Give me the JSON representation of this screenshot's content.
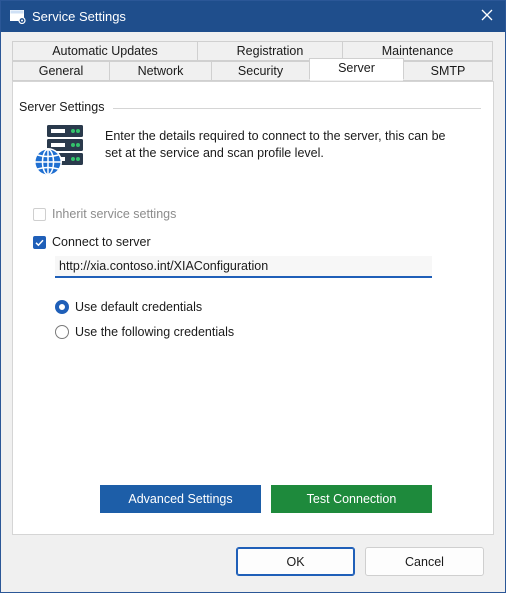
{
  "window": {
    "title": "Service Settings",
    "icon": "settings-window-icon",
    "close_icon": "close-icon"
  },
  "tabs": {
    "row1": [
      {
        "label": "Automatic Updates"
      },
      {
        "label": "Registration"
      },
      {
        "label": "Maintenance"
      }
    ],
    "row2": [
      {
        "label": "General"
      },
      {
        "label": "Network"
      },
      {
        "label": "Security"
      },
      {
        "label": "Server",
        "active": true
      },
      {
        "label": "SMTP"
      }
    ]
  },
  "server": {
    "group_title": "Server Settings",
    "icon": "server-globe-icon",
    "description": "Enter the details required to connect to the server, this can be set at the service and scan profile level.",
    "inherit_label": "Inherit service settings",
    "inherit_checked": false,
    "inherit_enabled": false,
    "connect_label": "Connect to server",
    "connect_checked": true,
    "url_value": "http://xia.contoso.int/XIAConfiguration",
    "credentials": [
      {
        "label": "Use default credentials",
        "selected": true
      },
      {
        "label": "Use the following credentials",
        "selected": false
      }
    ],
    "advanced_button": "Advanced Settings",
    "test_button": "Test Connection"
  },
  "dialog": {
    "ok_label": "OK",
    "cancel_label": "Cancel"
  },
  "colors": {
    "titlebar": "#1f4e8c",
    "accent": "#1f5fb8",
    "advanced_button": "#1d5ea8",
    "test_button": "#1e8a3c"
  }
}
